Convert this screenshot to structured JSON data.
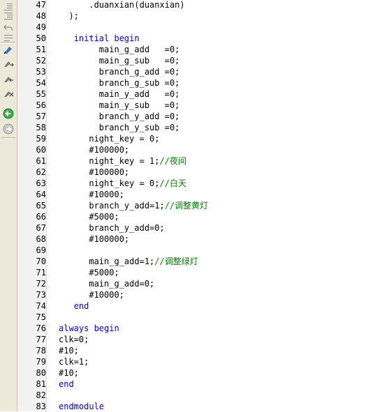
{
  "toolbar": {
    "buttons": [
      {
        "icon": "indent-lines-icon"
      },
      {
        "icon": "outdent-lines-icon"
      },
      {
        "icon": "undo-icon"
      },
      {
        "icon": "redo-icon"
      },
      {
        "icon": "bookmark-toggle-icon"
      },
      {
        "icon": "bookmark-next-icon"
      },
      {
        "icon": "bookmark-prev-icon"
      },
      {
        "icon": "bookmark-clear-icon"
      },
      {
        "icon": "go-back-icon"
      },
      {
        "icon": "go-forward-icon"
      }
    ]
  },
  "lines": [
    {
      "n": "47",
      "parts": [
        {
          "t": "      .duanxian(duanxian)",
          "c": ""
        }
      ]
    },
    {
      "n": "48",
      "parts": [
        {
          "t": "  );",
          "c": ""
        }
      ]
    },
    {
      "n": "49",
      "parts": []
    },
    {
      "n": "50",
      "parts": [
        {
          "t": "   ",
          "c": ""
        },
        {
          "t": "initial begin",
          "c": "kw"
        }
      ]
    },
    {
      "n": "51",
      "parts": [
        {
          "t": "        main_g_add   =0;",
          "c": ""
        }
      ]
    },
    {
      "n": "52",
      "parts": [
        {
          "t": "        main_g_sub   =0;",
          "c": ""
        }
      ]
    },
    {
      "n": "53",
      "parts": [
        {
          "t": "        branch_g_add =0;",
          "c": ""
        }
      ]
    },
    {
      "n": "54",
      "parts": [
        {
          "t": "        branch_g_sub =0;",
          "c": ""
        }
      ]
    },
    {
      "n": "55",
      "parts": [
        {
          "t": "        main_y_add   =0;",
          "c": ""
        }
      ]
    },
    {
      "n": "56",
      "parts": [
        {
          "t": "        main_y_sub   =0;",
          "c": ""
        }
      ]
    },
    {
      "n": "57",
      "parts": [
        {
          "t": "        branch_y_add =0;",
          "c": ""
        }
      ]
    },
    {
      "n": "58",
      "parts": [
        {
          "t": "        branch_y_sub =0;",
          "c": ""
        }
      ]
    },
    {
      "n": "59",
      "parts": [
        {
          "t": "      night_key = 0;",
          "c": ""
        }
      ]
    },
    {
      "n": "60",
      "parts": [
        {
          "t": "      #100000;",
          "c": ""
        }
      ]
    },
    {
      "n": "61",
      "parts": [
        {
          "t": "      night_key = 1;",
          "c": ""
        },
        {
          "t": "//夜间",
          "c": "cm"
        }
      ]
    },
    {
      "n": "62",
      "parts": [
        {
          "t": "      #100000;",
          "c": ""
        }
      ]
    },
    {
      "n": "63",
      "parts": [
        {
          "t": "      night_key = 0;",
          "c": ""
        },
        {
          "t": "//白天",
          "c": "cm"
        }
      ]
    },
    {
      "n": "64",
      "parts": [
        {
          "t": "      #10000;",
          "c": ""
        }
      ]
    },
    {
      "n": "65",
      "parts": [
        {
          "t": "      branch_y_add=1;",
          "c": ""
        },
        {
          "t": "//调整黄灯",
          "c": "cm"
        }
      ]
    },
    {
      "n": "66",
      "parts": [
        {
          "t": "      #5000;",
          "c": ""
        }
      ]
    },
    {
      "n": "67",
      "parts": [
        {
          "t": "      branch_y_add=0;",
          "c": ""
        }
      ]
    },
    {
      "n": "68",
      "parts": [
        {
          "t": "      #100000;",
          "c": ""
        }
      ]
    },
    {
      "n": "69",
      "parts": []
    },
    {
      "n": "70",
      "parts": [
        {
          "t": "      main_g_add=1;",
          "c": ""
        },
        {
          "t": "//调整绿灯",
          "c": "cm"
        }
      ]
    },
    {
      "n": "71",
      "parts": [
        {
          "t": "      #5000;",
          "c": ""
        }
      ]
    },
    {
      "n": "72",
      "parts": [
        {
          "t": "      main_g_add=0;",
          "c": ""
        }
      ]
    },
    {
      "n": "73",
      "parts": [
        {
          "t": "      #10000;",
          "c": ""
        }
      ]
    },
    {
      "n": "74",
      "parts": [
        {
          "t": "   ",
          "c": ""
        },
        {
          "t": "end",
          "c": "kw"
        }
      ]
    },
    {
      "n": "75",
      "parts": []
    },
    {
      "n": "76",
      "parts": [
        {
          "t": "always begin",
          "c": "kw"
        }
      ]
    },
    {
      "n": "77",
      "parts": [
        {
          "t": "clk=0;",
          "c": ""
        }
      ]
    },
    {
      "n": "78",
      "parts": [
        {
          "t": "#10;",
          "c": ""
        }
      ]
    },
    {
      "n": "79",
      "parts": [
        {
          "t": "clk=1;",
          "c": ""
        }
      ]
    },
    {
      "n": "80",
      "parts": [
        {
          "t": "#10;",
          "c": ""
        }
      ]
    },
    {
      "n": "81",
      "parts": [
        {
          "t": "end",
          "c": "kw"
        }
      ]
    },
    {
      "n": "82",
      "parts": []
    },
    {
      "n": "83",
      "parts": [
        {
          "t": "endmodule",
          "c": "kw"
        }
      ]
    }
  ],
  "colors": {
    "keyword": "#0000ff",
    "comment": "#008000",
    "text": "#000000",
    "gutter": "#f2f2f2",
    "toolbar": "#ece9d8"
  }
}
